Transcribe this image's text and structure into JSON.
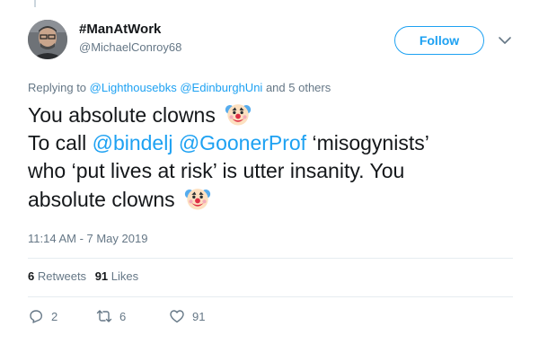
{
  "tweet": {
    "display_name": "#ManAtWork",
    "handle": "@MichaelConroy68",
    "follow_label": "Follow",
    "reply_prefix": "Replying to",
    "reply_mention_1": "@Lighthousebks",
    "reply_mention_2": "@EdinburghUni",
    "reply_suffix": "and 5 others",
    "text_line1": "You absolute clowns",
    "text_line2_prefix": "To call",
    "mention_1": "@bindelj",
    "mention_2": "@GoonerProf",
    "text_line2_suffix": "‘misogynists’",
    "text_line3": "who ‘put lives at risk’ is utter insanity. You",
    "text_line4": "absolute clowns",
    "timestamp": "11:14 AM - 7 May 2019",
    "emoji_1": "clown-face-emoji",
    "emoji_2": "clown-face-emoji"
  },
  "stats": {
    "retweets_count": "6",
    "retweets_label": "Retweets",
    "likes_count": "91",
    "likes_label": "Likes"
  },
  "actions": {
    "reply_icon": "reply-icon",
    "reply_count": "2",
    "retweet_icon": "retweet-icon",
    "retweet_count": "6",
    "like_icon": "heart-icon",
    "like_count": "91"
  },
  "colors": {
    "accent": "#1da1f2",
    "text": "#14171a",
    "muted": "#657786",
    "divider": "#e6ecf0"
  }
}
